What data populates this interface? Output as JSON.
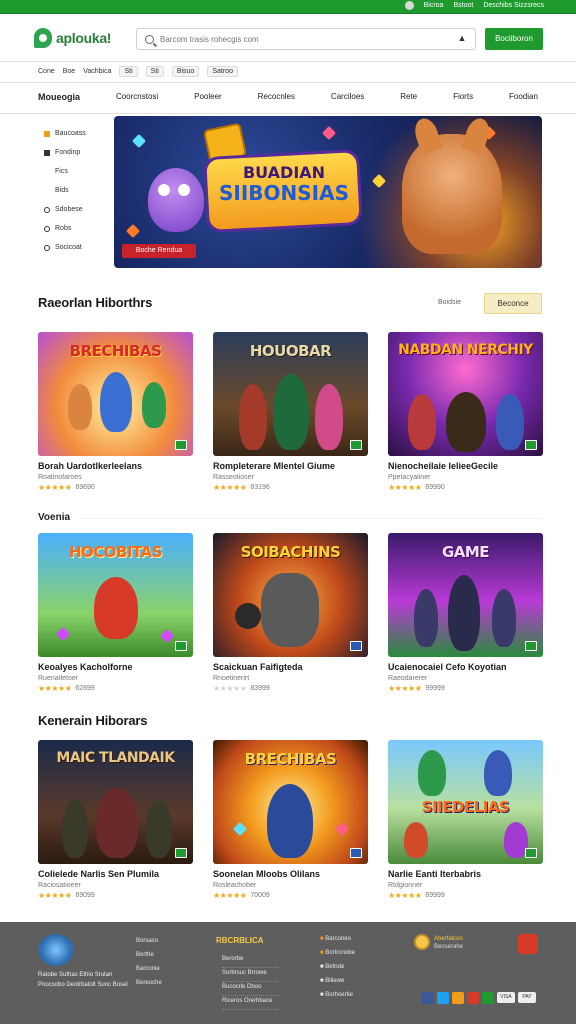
{
  "topbar": {
    "links": [
      "Bicroa",
      "Bstoot",
      "Deschibs Sizzsrecs"
    ],
    "accent": "#1f9a2e"
  },
  "header": {
    "logo_text": "aplouka!",
    "search_placeholder": "Barcom trasis rohecgis com",
    "cta_label": "Bociiboron"
  },
  "subnav": [
    "Cone",
    "Boe",
    "Vachbica",
    "Sti",
    "Sti",
    "Bisuo",
    "Satroo"
  ],
  "mainnav": [
    "Moueogia",
    "Coorcnstosi",
    "Pooleer",
    "Recocnles",
    "Carciloes",
    "Rete",
    "Fiorts",
    "Foodian"
  ],
  "sidebar": [
    "Baucoass",
    "Fondinp",
    "Fics",
    "Bids",
    "Sdobese",
    "Robs",
    "Socicoat"
  ],
  "hero": {
    "title_line1": "BUADIAN",
    "title_line2": "SIIBONSIAS",
    "button_label": "Boche Rendua"
  },
  "section1": {
    "title": "Raeorlan Hiborthrs",
    "filter_text": "Boidsie",
    "filter_button": "Beconce"
  },
  "row_label": "Voenia",
  "section2": {
    "title": "Kenerain Hiborars"
  },
  "cards": [
    {
      "thumb_title": "BRECHIBAS",
      "title": "Borah Uardotlkerleelans",
      "sub": "Roatinofaroes",
      "rating": "4.5",
      "count": "69690"
    },
    {
      "thumb_title": "HOUOBAR",
      "title": "Rompleterare Mlentel  Giume",
      "sub": "Rasseotioser",
      "rating": "4.5",
      "count": "83196"
    },
    {
      "thumb_title": "NABDAN NERCHIY",
      "title": "Nienocheilaie lelieeGecile",
      "sub": "Ppetacyaiiner",
      "rating": "4.5",
      "count": "69990"
    },
    {
      "thumb_title": "HOCOBITAS",
      "title": "Keoalyes Kacholforne",
      "sub": "Ruenatletoer",
      "rating": "4.5",
      "count": "62899"
    },
    {
      "thumb_title": "SOIBACHINS",
      "title": "Scaickuan Faifigteda",
      "sub": "Rnoetinerirt",
      "rating": "0",
      "count": "83999"
    },
    {
      "thumb_title": "GAME",
      "title": "Ucaienocaiel Cefo Koyotian",
      "sub": "Raeodarerer",
      "rating": "4.5",
      "count": "99999"
    },
    {
      "thumb_title": "MAIC TLANDAIK",
      "title": "Colielede Narlis Sen Plumila",
      "sub": "Raciosatioeer",
      "rating": "4.5",
      "count": "69099"
    },
    {
      "thumb_title": "BRECHIBAS",
      "title": "Soonelan Mloobs Olilans",
      "sub": "Rosleachober",
      "rating": "4.5",
      "count": "70009"
    },
    {
      "thumb_title": "SIIEDELIAS",
      "title": "Narlie Eanti Iterbabris",
      "sub": "Rtdgionner",
      "rating": "4.5",
      "count": "69999"
    }
  ],
  "footer": {
    "about_lines": [
      "Ratobe Suthas Ethio Srutan",
      "Poocsobo Deotrbatolt Sunc Bosel"
    ],
    "col1": [
      "Borsaco",
      "Berthe",
      "Barconie",
      "Bereoche"
    ],
    "col2_brand": "RBCRBLICA",
    "col2": [
      "Berorbe",
      "Sorbrsuc Brrowe",
      "Bucocrle Dboo",
      "Riceros Orerhbace"
    ],
    "col3": [
      "Barconeo",
      "Bortronobe",
      "Betnde",
      "Biliewe",
      "Borhoertie"
    ],
    "col4_brand": "Aberfalcoo",
    "col4_sub": "Benserahe",
    "payments": [
      "VISA",
      "PAY"
    ]
  },
  "colors": {
    "brand_green": "#1f9a2e",
    "star": "#f1a81b",
    "hero_button": "#c8222a",
    "footer_bg": "#5e5e5e"
  }
}
